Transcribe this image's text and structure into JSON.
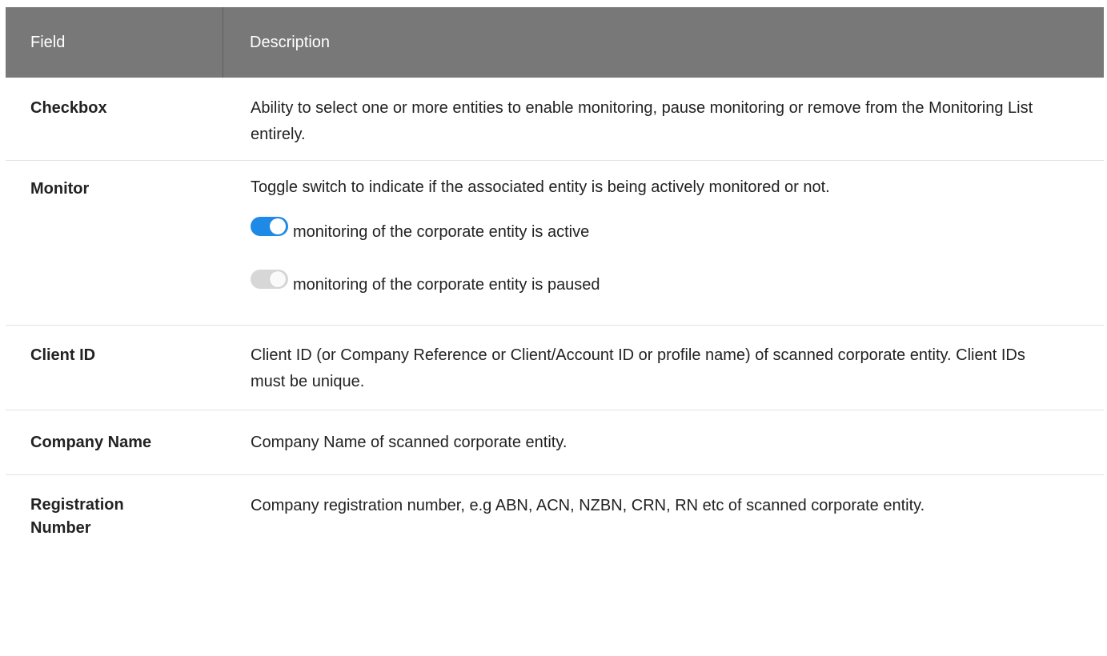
{
  "header": {
    "field": "Field",
    "description": "Description"
  },
  "rows": {
    "checkbox": {
      "field": "Checkbox",
      "description": "Ability to select one or more entities to enable monitoring, pause monitoring or remove from the Monitoring List entirely."
    },
    "monitor": {
      "field": "Monitor",
      "description": "Toggle switch to indicate if the associated entity is being actively monitored or not.",
      "active_text": "monitoring of the corporate entity is active",
      "paused_text": "monitoring of the corporate entity is paused",
      "active_color": "#1e8ae6",
      "paused_color": "#d7d7d7"
    },
    "client_id": {
      "field": "Client ID",
      "description": "Client ID (or Company Reference or Client/Account ID or profile name) of scanned corporate entity. Client IDs must be unique."
    },
    "company_name": {
      "field": "Company Name",
      "description": "Company Name of scanned corporate entity."
    },
    "registration_number": {
      "field_line1": "Registration",
      "field_line2": "Number",
      "description": "Company registration number, e.g ABN, ACN, NZBN, CRN, RN etc of scanned corporate entity."
    }
  },
  "colors": {
    "header_bg": "#787878",
    "header_text": "#ffffff",
    "divider": "#e2e2e2"
  }
}
